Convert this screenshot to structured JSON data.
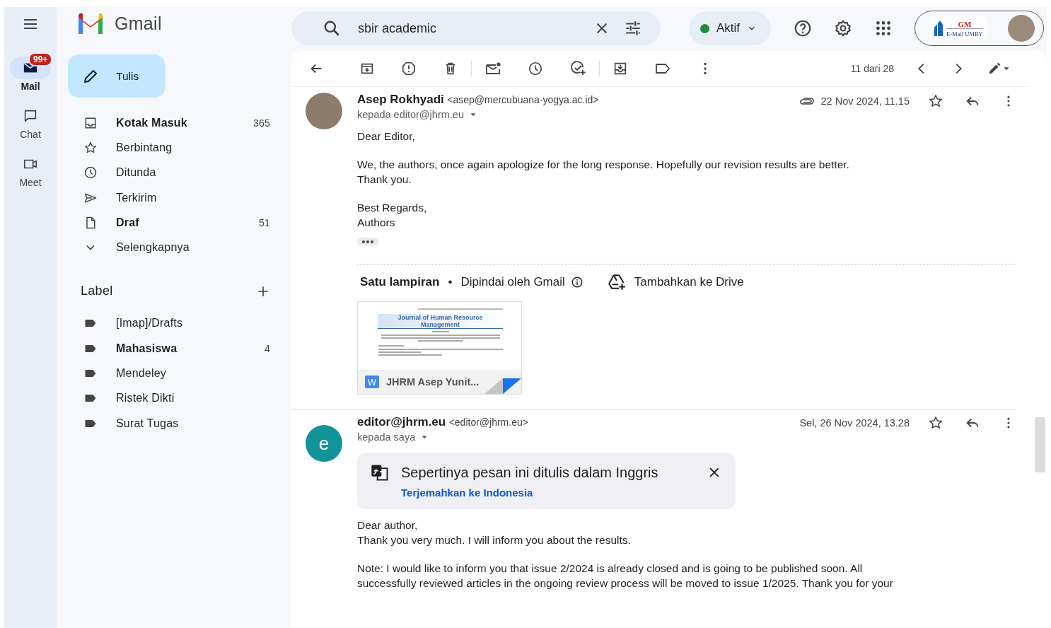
{
  "app": {
    "title": "Gmail"
  },
  "rail": [
    {
      "label": "Mail",
      "selected": true,
      "badge": "99+",
      "kind": "mail"
    },
    {
      "label": "Chat",
      "selected": false,
      "kind": "chat"
    },
    {
      "label": "Meet",
      "selected": false,
      "kind": "meet"
    }
  ],
  "compose": {
    "label": "Tulis"
  },
  "folders": [
    {
      "label": "Kotak Masuk",
      "count": "365",
      "unread": true,
      "kind": "inbox"
    },
    {
      "label": "Berbintang",
      "unread": false,
      "kind": "star"
    },
    {
      "label": "Ditunda",
      "unread": false,
      "kind": "clock"
    },
    {
      "label": "Terkirim",
      "unread": false,
      "kind": "send"
    },
    {
      "label": "Draf",
      "count": "51",
      "unread": true,
      "kind": "file"
    },
    {
      "label": "Selengkapnya",
      "unread": false,
      "kind": "more"
    }
  ],
  "labels_section": {
    "title": "Label"
  },
  "labels": [
    {
      "label": "[Imap]/Drafts",
      "unread": false
    },
    {
      "label": "Mahasiswa",
      "count": "4",
      "unread": true
    },
    {
      "label": "Mendeley",
      "unread": false
    },
    {
      "label": "Ristek Dikti",
      "unread": false
    },
    {
      "label": "Surat Tugas",
      "unread": false
    }
  ],
  "search": {
    "value": "sbir academic"
  },
  "status": {
    "label": "Aktif",
    "color": "#1e8e3e"
  },
  "account": {
    "logo_mark": "GM",
    "logo_text": "E-Mail UMBY"
  },
  "toolbar": {
    "position": "11 dari 28"
  },
  "messages": [
    {
      "sender": "Asep Rokhyadi",
      "email": "<asep@mercubuana-yogya.ac.id>",
      "recipient": "kepada editor@jhrm.eu",
      "date": "22 Nov 2024, 11.15",
      "has_attachment": true,
      "avatar": {
        "kind": "photo"
      },
      "paragraphs": [
        [
          "Dear Editor,"
        ],
        [
          "We, the authors, once again apologize for the long response. Hopefully our revision results are better.",
          "Thank you."
        ],
        [
          "Best Regards,",
          "Authors"
        ]
      ],
      "trimmed": true,
      "attachments": {
        "title": "Satu lampiran",
        "separator": "•",
        "scan": "Dipindai oleh Gmail",
        "drive": "Tambahkan ke Drive",
        "files": [
          {
            "name": "JHRM Asep Yunit...",
            "icon_letter": "W",
            "preview": {
              "title": "Journal of Human Resource Management"
            }
          }
        ]
      }
    },
    {
      "sender": "editor@jhrm.eu",
      "email": "<editor@jhrm.eu>",
      "recipient": "kepada saya",
      "date": "Sel, 26 Nov 2024, 13.28",
      "has_attachment": false,
      "avatar": {
        "kind": "letter",
        "letter": "e"
      },
      "translate": {
        "message": "Sepertinya pesan ini ditulis dalam Inggris",
        "link": "Terjemahkan ke Indonesia"
      },
      "paragraphs": [
        [
          "Dear author,",
          "Thank you very much. I will inform you about the results."
        ],
        [
          "Note: I would like to inform you that issue 2/2024 is already closed and is going to be published soon. All",
          "successfully reviewed articles in the ongoing review process will be moved to issue 1/2025. Thank you for your"
        ]
      ],
      "trimmed": false
    }
  ]
}
